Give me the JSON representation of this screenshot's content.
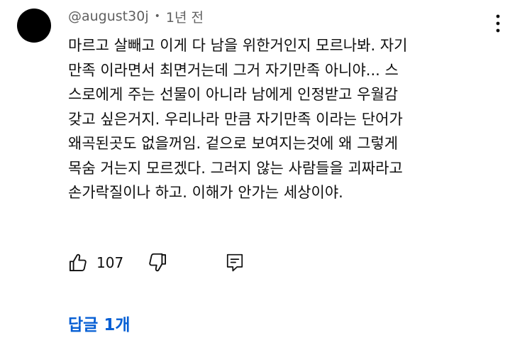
{
  "comment": {
    "author": "@august30j",
    "separator": "•",
    "timestamp": "1년 전",
    "text_lines": [
      "마르고 살빼고 이게 다 남을 위한거인지 모르나봐. 자기",
      "만족 이라면서 최면거는데 그거 자기만족 아니야... 스",
      "스로에게 주는 선물이 아니라 남에게 인정받고 우월감",
      "갖고 싶은거지. 우리나라 만큼 자기만족 이라는 단어가",
      "왜곡된곳도 없을꺼임. 겉으로 보여지는것에 왜 그렇게",
      "목숨 거는지 모르겠다. 그러지 않는 사람들을 괴짜라고",
      "손가락질이나 하고. 이해가 안가는 세상이야."
    ],
    "like_count": "107",
    "replies_label": "답글 1개"
  },
  "icons": {
    "menu": "more-vert-icon",
    "like": "thumbs-up-icon",
    "dislike": "thumbs-down-icon",
    "reply": "reply-comment-icon"
  },
  "colors": {
    "avatar": "#000000",
    "meta_text": "#606060",
    "body_text": "#0f0f0f",
    "link": "#065fd4"
  }
}
